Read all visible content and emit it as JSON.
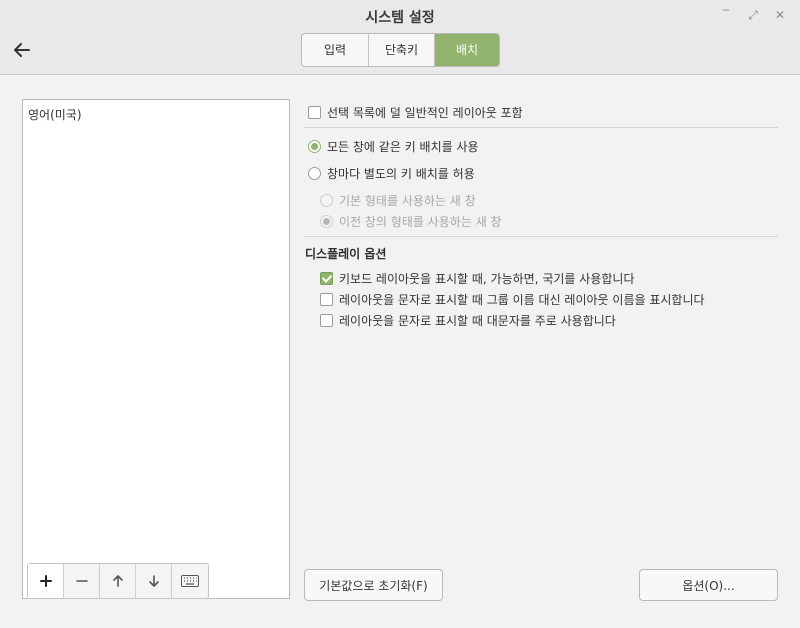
{
  "window": {
    "title": "시스템 설정",
    "controls": {
      "minimize": "‾",
      "maximize": "⤢",
      "close": "✕"
    }
  },
  "tabs": [
    {
      "label": "입력",
      "active": false
    },
    {
      "label": "단축키",
      "active": false
    },
    {
      "label": "배치",
      "active": true
    }
  ],
  "layouts_list": {
    "items": [
      "영어(미국)"
    ]
  },
  "options": {
    "include_uncommon": "선택 목록에 덜 일반적인 레이아웃 포함",
    "same_layout_all": "모든 창에 같은 키 배치를 사용",
    "per_window": "창마다 별도의 키 배치를 허용",
    "new_window_default": "기본 형태를 사용하는 새 창",
    "new_window_previous": "이전 창의 형태를 사용하는 새 창"
  },
  "display_options": {
    "title": "디스플레이 옵션",
    "show_flags": "키보드 레이아웃을 표시할 때, 가능하면, 국기를 사용합니다",
    "show_layout_names": "레이아웃을 문자로 표시할 때 그룹 이름 대신 레이아웃 이름을 표시합니다",
    "use_uppercase": "레이아웃을 문자로 표시할 때 대문자를 주로 사용합니다"
  },
  "buttons": {
    "reset": "기본값으로 초기화(F)",
    "options": "옵션(O)..."
  },
  "colors": {
    "accent": "#92b46f"
  }
}
